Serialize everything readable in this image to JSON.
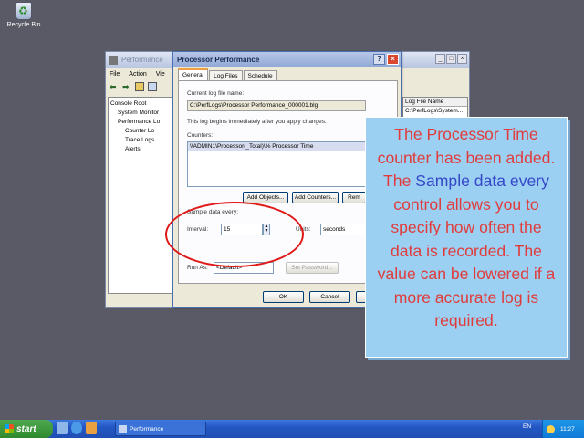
{
  "desktop": {
    "recycle_bin_label": "Recycle Bin"
  },
  "mmc": {
    "title": "Performance",
    "menu": [
      "File",
      "Action",
      "Vie"
    ],
    "tree": [
      "Console Root",
      "System Monitor",
      "Performance Lo",
      "Counter Lo",
      "Trace Logs",
      "Alerts"
    ],
    "list_header": "Log File Name",
    "list_row": "C:\\PerfLogs\\System..."
  },
  "dialog": {
    "title": "Processor Performance",
    "tabs": [
      "General",
      "Log Files",
      "Schedule"
    ],
    "current_log_label": "Current log file name:",
    "current_log_value": "C:\\PerfLogs\\Processor Performance_000001.blg",
    "log_begins_text": "This log begins immediately after you apply changes.",
    "counters_label": "Counters:",
    "counter_item": "\\\\ADMIN1\\Processor(_Total)\\% Processor Time",
    "add_objects": "Add Objects...",
    "add_counters": "Add Counters...",
    "remove": "Rem",
    "sample_label": "Sample data every:",
    "interval_label": "Interval:",
    "interval_value": "15",
    "units_label": "Units:",
    "units_value": "seconds",
    "run_as_label": "Run As:",
    "run_as_value": "<Default>",
    "set_password": "Set Password...",
    "ok": "OK",
    "cancel": "Cancel"
  },
  "callout": {
    "part1": "The Processor Time counter has been added. The ",
    "highlight": "Sample data every",
    "part2": " control allows you to specify how often the data is recorded. The value can be lowered if a more accurate log is required."
  },
  "taskbar": {
    "start_label": "start",
    "task_label": "Performance",
    "language": "EN",
    "clock": "11:27"
  },
  "colors": {
    "callout_text": "#e03c3c",
    "callout_highlight": "#3548c8",
    "callout_bg": "#9cd0f2",
    "annotation_circle": "#e01818"
  }
}
